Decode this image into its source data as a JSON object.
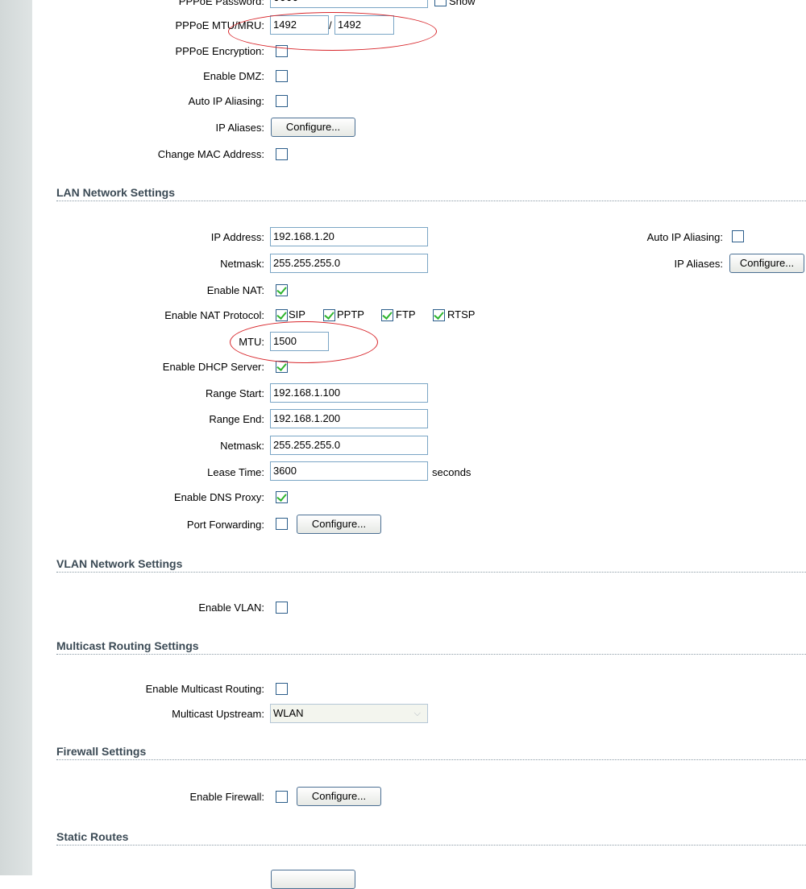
{
  "wan": {
    "pppoe_password_label": "PPPoE Password:",
    "pppoe_password_value": "●●●●",
    "show_label": "Show",
    "pppoe_mtu_label": "PPPoE MTU/MRU:",
    "pppoe_mtu_value": "1492",
    "pppoe_mtu_slash": "/",
    "pppoe_mru_value": "1492",
    "pppoe_encryption_label": "PPPoE Encryption:",
    "enable_dmz_label": "Enable DMZ:",
    "auto_ip_aliasing_label": "Auto IP Aliasing:",
    "ip_aliases_label": "IP Aliases:",
    "ip_aliases_button": "Configure...",
    "change_mac_label": "Change MAC Address:"
  },
  "lan": {
    "title": "LAN Network Settings",
    "ip_address_label": "IP Address:",
    "ip_address_value": "192.168.1.20",
    "netmask_label": "Netmask:",
    "netmask_value": "255.255.255.0",
    "auto_ip_aliasing_label": "Auto IP Aliasing:",
    "ip_aliases_label": "IP Aliases:",
    "ip_aliases_button": "Configure...",
    "enable_nat_label": "Enable NAT:",
    "nat_protocol_label": "Enable NAT Protocol:",
    "nat_protocols": [
      "SIP",
      "PPTP",
      "FTP",
      "RTSP"
    ],
    "mtu_label": "MTU:",
    "mtu_value": "1500",
    "dhcp_label": "Enable DHCP Server:",
    "range_start_label": "Range Start:",
    "range_start_value": "192.168.1.100",
    "range_end_label": "Range End:",
    "range_end_value": "192.168.1.200",
    "dhcp_netmask_label": "Netmask:",
    "dhcp_netmask_value": "255.255.255.0",
    "lease_time_label": "Lease Time:",
    "lease_time_value": "3600",
    "lease_time_unit": "seconds",
    "dns_proxy_label": "Enable DNS Proxy:",
    "port_forwarding_label": "Port Forwarding:",
    "port_forwarding_button": "Configure..."
  },
  "vlan": {
    "title": "VLAN Network Settings",
    "enable_vlan_label": "Enable VLAN:"
  },
  "multicast": {
    "title": "Multicast Routing Settings",
    "enable_label": "Enable Multicast Routing:",
    "upstream_label": "Multicast Upstream:",
    "upstream_value": "WLAN"
  },
  "firewall": {
    "title": "Firewall Settings",
    "enable_label": "Enable Firewall:",
    "configure_button": "Configure..."
  },
  "static_routes": {
    "title": "Static Routes"
  },
  "colors": {
    "annotation_ellipse": "#d8262b",
    "checkmark": "#2fb52f",
    "input_border": "#7aa5c5"
  }
}
